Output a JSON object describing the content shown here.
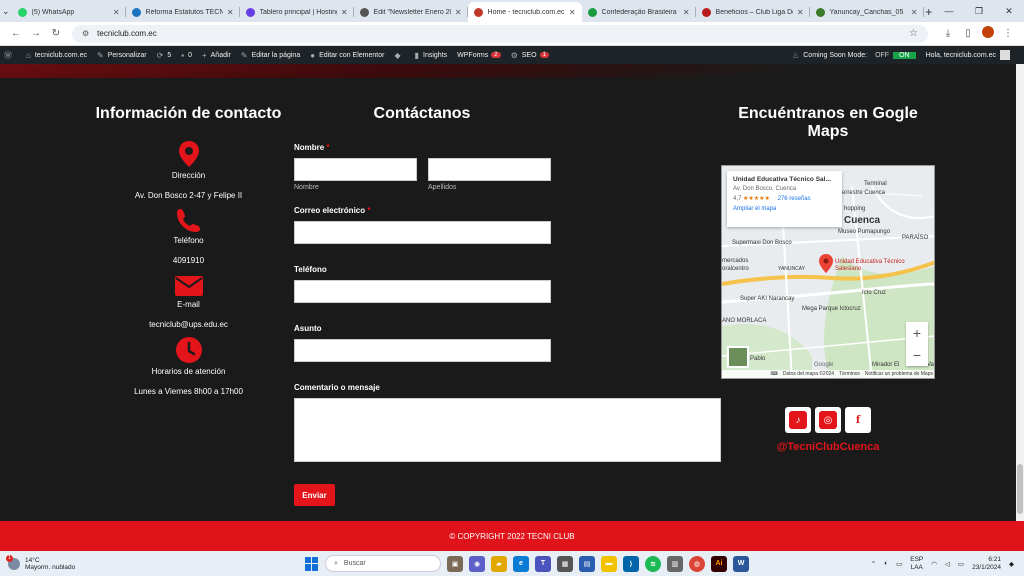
{
  "browser": {
    "tabs": [
      {
        "title": "(5) WhatsApp",
        "color": "#25d366"
      },
      {
        "title": "Reforma Estatutos TECNI",
        "color": "#1e73be"
      },
      {
        "title": "Tablero principal | Hosting",
        "color": "#673de6"
      },
      {
        "title": "Edit \"Newsletter Enero 20",
        "color": "#555555"
      },
      {
        "title": "Home - tecniclub.com.ec",
        "color": "#c0392b"
      },
      {
        "title": "Confederação Brasileira d",
        "color": "#1a9c3e"
      },
      {
        "title": "Beneficios – Club Liga De",
        "color": "#b71c1c"
      },
      {
        "title": "Yanuncay_Canchas_05",
        "color": "#3b7a2a"
      }
    ],
    "active_tab": 4,
    "url": "tecniclub.com.ec"
  },
  "wpbar": {
    "site": "tecniclub.com.ec",
    "customize": "Personalizar",
    "updates": "5",
    "comments": "0",
    "add_new": "Añadir",
    "edit_page": "Editar la página",
    "elementor": "Editar con Elementor",
    "insights": "Insights",
    "wpforms": "WPForms",
    "wpforms_badge": "2",
    "seo": "SEO",
    "seo_badge": "1",
    "coming_soon": "Coming Soon Mode:",
    "coming_off": "OFF",
    "coming_on": "ON",
    "greeting": "Hola, tecniclub.com.ec"
  },
  "contact_info": {
    "title": "Información de contacto",
    "address_label": "Dirección",
    "address": "Av. Don Bosco 2-47 y Felipe II",
    "phone_label": "Teléfono",
    "phone": "4091910",
    "email_label": "E-mail",
    "email": "tecniclub@ups.edu.ec",
    "hours_label": "Horarios de atención",
    "hours": "Lunes a Viernes 8h00 a 17h00"
  },
  "form": {
    "title": "Contáctanos",
    "name_label": "Nombre",
    "required_mark": "*",
    "first_name_sub": "Nombre",
    "last_name_sub": "Apellidos",
    "email_label": "Correo electrónico",
    "phone_label": "Teléfono",
    "subject_label": "Asunto",
    "message_label": "Comentario o mensaje",
    "submit": "Enviar"
  },
  "map_section": {
    "title": "Encuéntranos en Gogle Maps",
    "card_title": "Unidad Educativa Técnico Sal...",
    "card_address": "Av. Don Bosco, Cuenca",
    "card_rating": "4,7",
    "card_stars": "★★★★★",
    "card_reviews": "276 reseñas",
    "card_link": "Ampliar el mapa",
    "labels": {
      "cuenca": "Cuenca",
      "terminal": "Terminal",
      "pin_label": "Unidad Educativa Técnico Salesiano",
      "supermaxi": "Supermaxi Don Bosco",
      "museo": "Museo Pumapungo",
      "yanuncay": "YANUNCAY",
      "super_aki": "Super AKI Narancay",
      "icto_cruz": "Icto Cruz",
      "mega": "Mega Parque Ictocruz",
      "morlaca": "ANO MORLACA",
      "mercados": "mercados",
      "coralcentro": "oralcentro",
      "shopping": "hopping",
      "terrestre": "errestre Cuenca",
      "paraiso": "PARAÍSO",
      "pablo": "Pablo",
      "mirador": "Mirador El",
      "elva": "El Va",
      "google": "Google"
    },
    "zoom_in": "+",
    "zoom_out": "−",
    "footer_data": "Datos del mapa ©2024",
    "footer_terms": "Términos",
    "footer_report": "Notificar un problema de Maps",
    "social_handle": "@TecniClubCuenca"
  },
  "footer": {
    "copyright": "© COPYRIGHT 2022 TECNI CLUB"
  },
  "taskbar": {
    "temp": "14°C",
    "weather": "Mayorm. nublado",
    "weather_badge": "1",
    "search": "Buscar",
    "lang1": "ESP",
    "lang2": "LAA",
    "time": "6:21",
    "date": "23/1/2024"
  }
}
